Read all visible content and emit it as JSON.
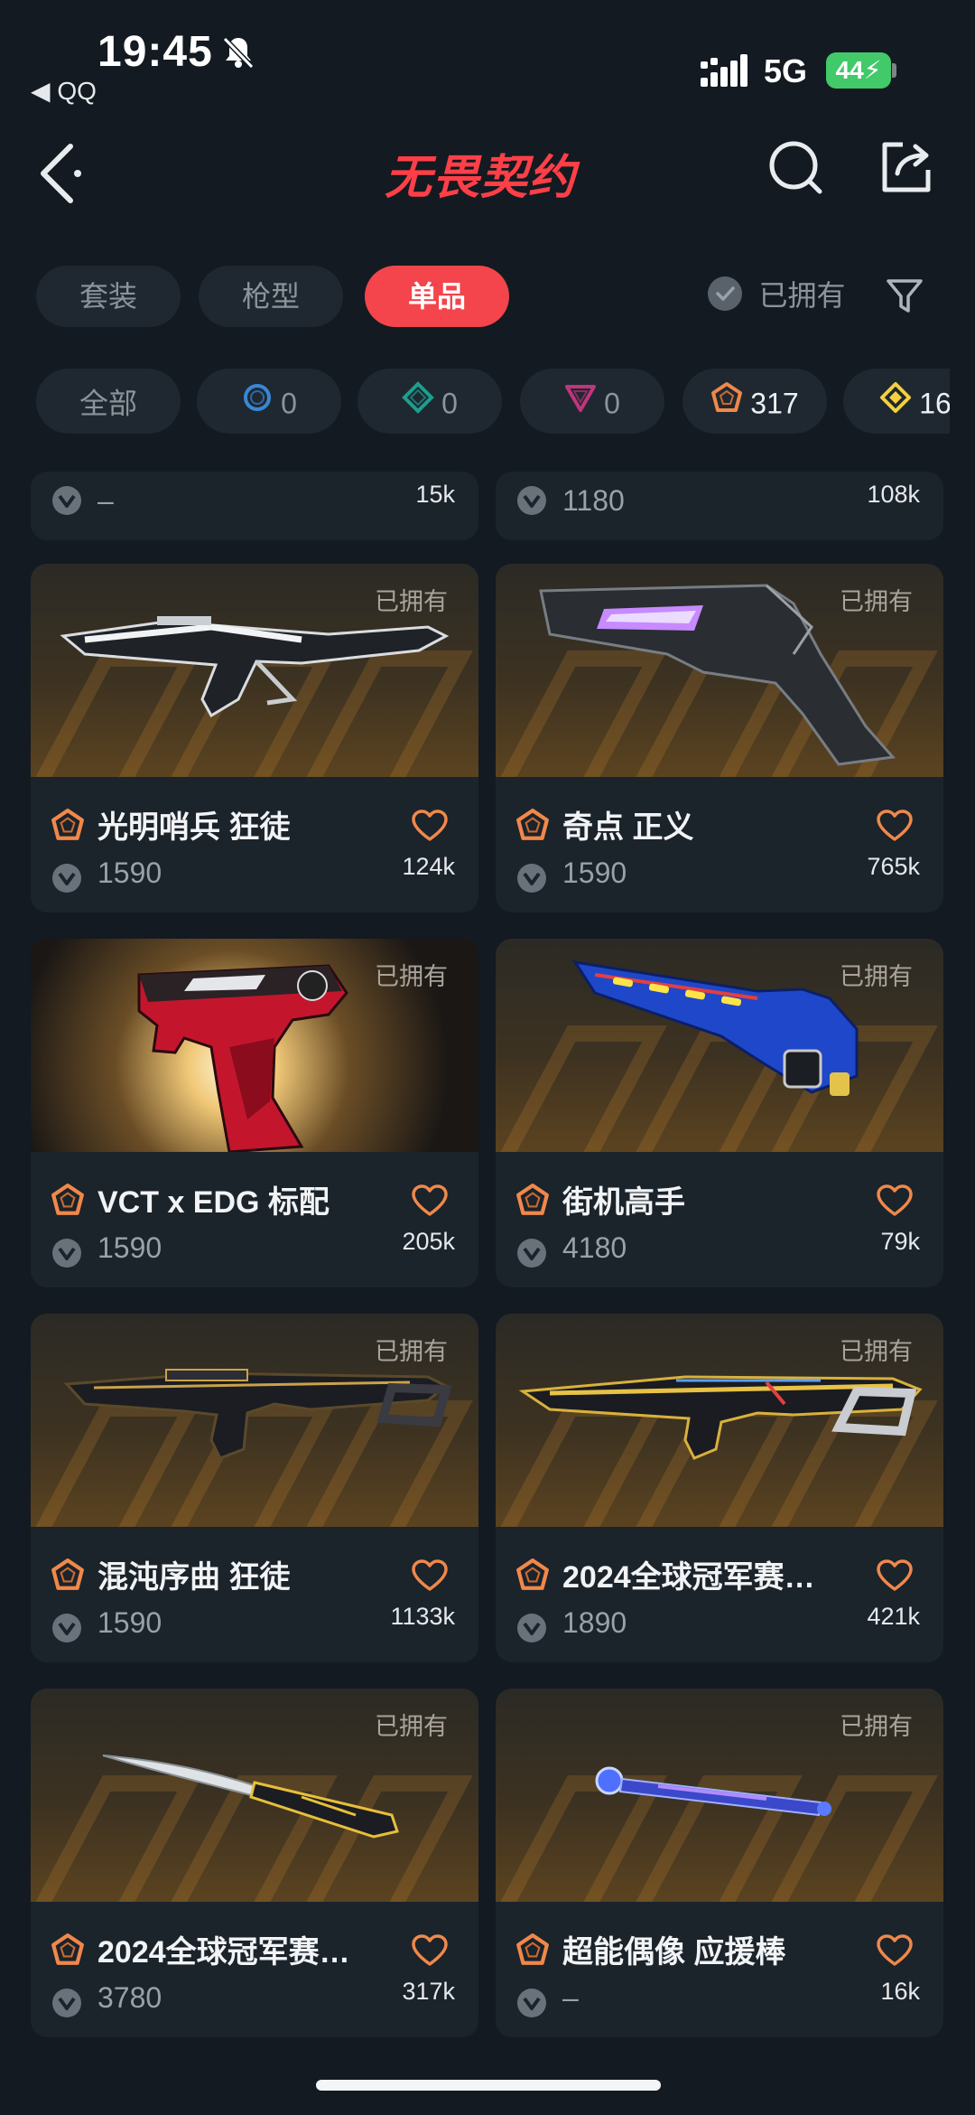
{
  "status": {
    "time": "19:45",
    "back_app": "◀ QQ",
    "network": "5G",
    "battery": "44"
  },
  "header": {
    "title": "无畏契约"
  },
  "category_tabs": [
    {
      "label": "套装",
      "active": false
    },
    {
      "label": "枪型",
      "active": false
    },
    {
      "label": "单品",
      "active": true
    }
  ],
  "owned_filter": {
    "label": "已拥有"
  },
  "tier_chips": [
    {
      "label": "全部",
      "icon": "none"
    },
    {
      "label": "0",
      "icon": "select-tier-icon",
      "color": "#3a86d4"
    },
    {
      "label": "0",
      "icon": "deluxe-tier-icon",
      "color": "#1e9e8f"
    },
    {
      "label": "0",
      "icon": "premium-tier-icon",
      "color": "#c0357e"
    },
    {
      "label": "317",
      "icon": "exclusive-tier-icon",
      "color": "#f0884a"
    },
    {
      "label": "16",
      "icon": "ultra-tier-icon",
      "color": "#f4d03f"
    }
  ],
  "top_partial_cards": [
    {
      "price": "–",
      "likes": "15k"
    },
    {
      "price": "1180",
      "likes": "108k"
    }
  ],
  "cards": [
    {
      "owned_label": "已拥有",
      "name": "光明哨兵 狂徒",
      "price": "1590",
      "likes": "124k"
    },
    {
      "owned_label": "已拥有",
      "name": "奇点 正义",
      "price": "1590",
      "likes": "765k"
    },
    {
      "owned_label": "已拥有",
      "name": "VCT x EDG 标配",
      "price": "1590",
      "likes": "205k"
    },
    {
      "owned_label": "已拥有",
      "name": "街机高手",
      "price": "4180",
      "likes": "79k"
    },
    {
      "owned_label": "已拥有",
      "name": "混沌序曲 狂徒",
      "price": "1590",
      "likes": "1133k"
    },
    {
      "owned_label": "已拥有",
      "name": "2024全球冠军赛…",
      "price": "1890",
      "likes": "421k"
    },
    {
      "owned_label": "已拥有",
      "name": "2024全球冠军赛…",
      "price": "3780",
      "likes": "317k"
    },
    {
      "owned_label": "已拥有",
      "name": "超能偶像 应援棒",
      "price": "–",
      "likes": "16k"
    }
  ],
  "colors": {
    "accent": "#f4454c",
    "tier_exclusive": "#f0884a",
    "heart": "#f0884a",
    "background": "#131a21"
  }
}
